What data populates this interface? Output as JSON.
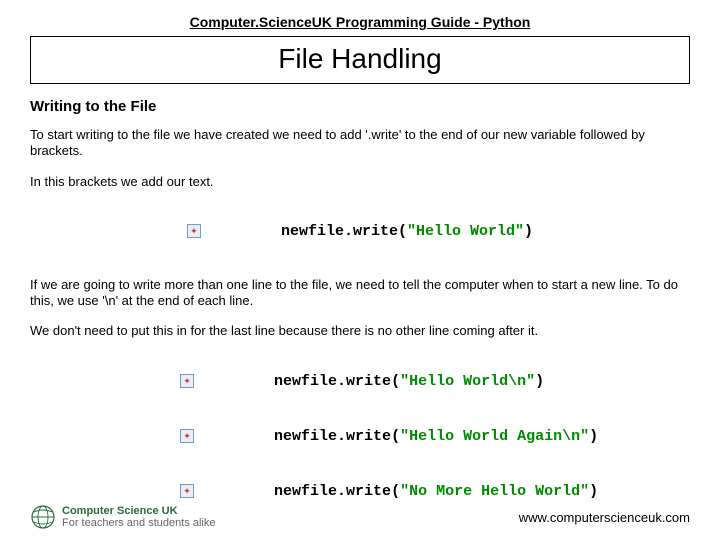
{
  "header": "Computer.ScienceUK Programming Guide - Python",
  "title": "File Handling",
  "section": "Writing to the File",
  "p1": "To start writing to the file we have created we need to add '.write' to the end of our new variable followed by brackets.",
  "p2": "In this brackets we add our text.",
  "code1": {
    "ident": "newfile",
    "method": "write",
    "str": "\"Hello World\""
  },
  "p3": "If we are going to write more than one line to the file, we need to tell the computer when to start a new line. To do this, we use '\\n' at the end of each line.",
  "p4": "We don't need to put this in for the last line because there is no other line coming after it.",
  "code2": [
    {
      "ident": "newfile",
      "method": "write",
      "str": "\"Hello World\\n\""
    },
    {
      "ident": "newfile",
      "method": "write",
      "str": "\"Hello World Again\\n\""
    },
    {
      "ident": "newfile",
      "method": "write",
      "str": "\"No More Hello World\""
    }
  ],
  "footer": {
    "logo_line1": "Computer Science UK",
    "logo_line2": "For teachers and students alike",
    "url": "www.computerscienceuk.com"
  }
}
